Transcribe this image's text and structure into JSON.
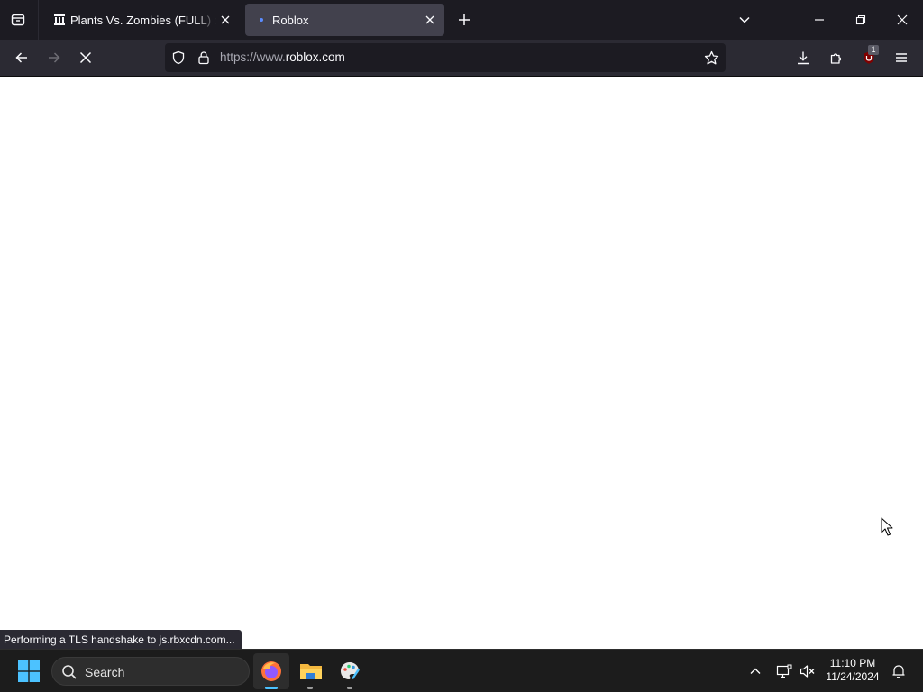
{
  "browser": {
    "tabs": [
      {
        "title": "Plants Vs. Zombies (FULL) : Pop",
        "favicon": "archive-building-icon",
        "active": false
      },
      {
        "title": "Roblox",
        "favicon": "loading-dot-icon",
        "active": true
      }
    ],
    "url": {
      "scheme": "https://www.",
      "domain": "roblox.com"
    },
    "extension_badge": "1",
    "colors": {
      "frame": "#1c1b22",
      "toolbar": "#2b2a33",
      "active_tab": "#42414d",
      "urlbar": "#1c1b22",
      "text": "#fbfbfe",
      "ublock": "#800000"
    }
  },
  "status": {
    "message": "Performing a TLS handshake to js.rbxcdn.com..."
  },
  "taskbar": {
    "search_label": "Search",
    "apps": [
      "firefox-icon",
      "file-explorer-icon",
      "paint-icon"
    ],
    "clock": {
      "time": "11:10 PM",
      "date": "11/24/2024"
    },
    "colors": {
      "background": "#1c1c1c",
      "start": "#4cc2ff"
    }
  }
}
